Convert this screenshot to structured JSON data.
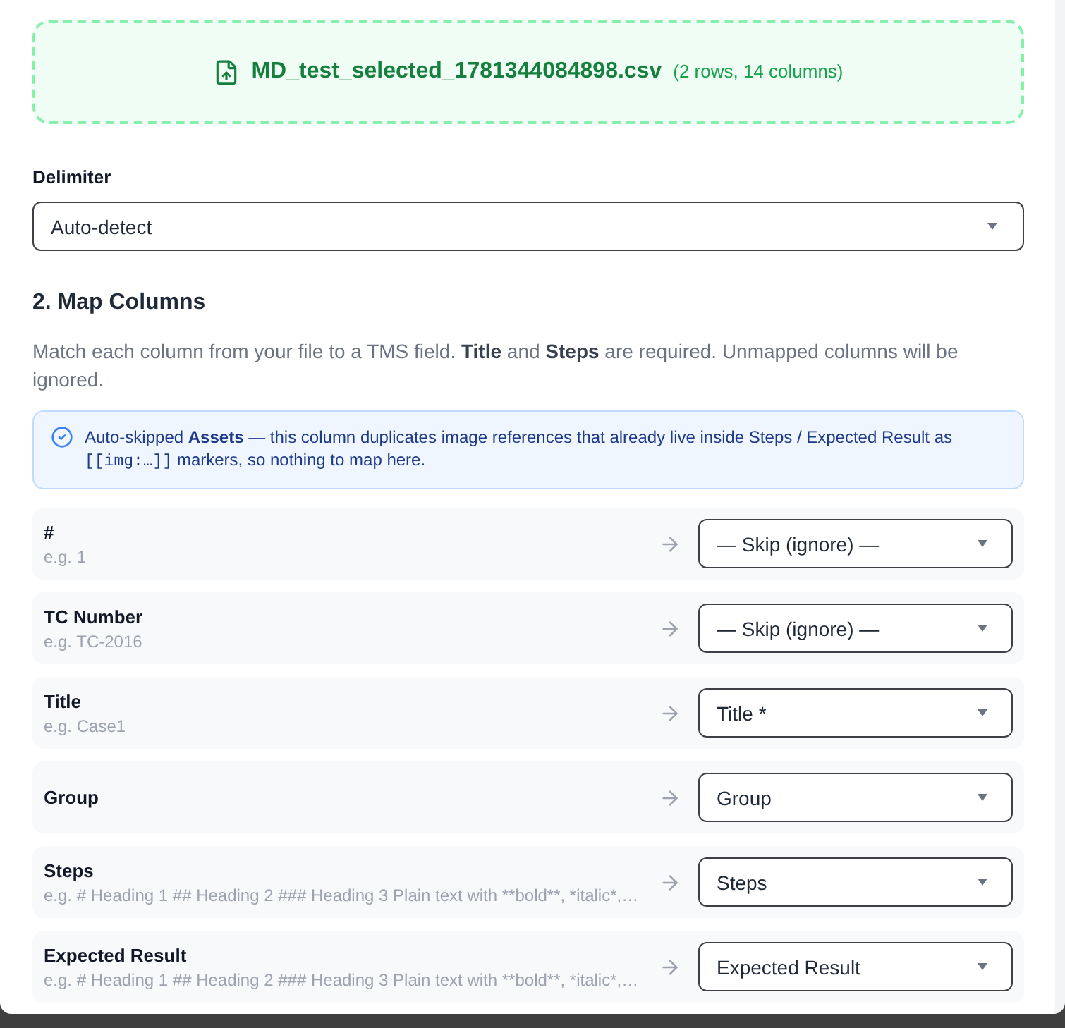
{
  "upload": {
    "file_name": "MD_test_selected_1781344084898.csv",
    "summary": "(2 rows, 14 columns)"
  },
  "delimiter": {
    "label": "Delimiter",
    "value": "Auto-detect"
  },
  "map_columns": {
    "heading": "2. Map Columns",
    "description": "Match each column from your file to a TMS field. **Title** and **Steps** are required. Unmapped columns will be ignored.",
    "notice": {
      "text": "Auto-skipped **Assets** — this column duplicates image references that already live inside Steps / Expected Result as",
      "code": "[[img:…]]",
      "text_after": "markers, so nothing to map here."
    },
    "rows": [
      {
        "column": "#",
        "example": "e.g. 1",
        "mapping": "— Skip (ignore) —"
      },
      {
        "column": "TC Number",
        "example": "e.g. TC-2016",
        "mapping": "— Skip (ignore) —"
      },
      {
        "column": "Title",
        "example": "e.g. Case1",
        "mapping": "Title *"
      },
      {
        "column": "Group",
        "mapping": "Group"
      },
      {
        "column": "Steps",
        "example": "e.g. # Heading 1 ## Heading 2 ### Heading 3 Plain text with **bold**, *italic*,…",
        "mapping": "Steps"
      },
      {
        "column": "Expected Result",
        "example": "e.g. # Heading 1 ## Heading 2 ### Heading 3 Plain text with **bold**, *italic*,…",
        "mapping": "Expected Result"
      }
    ]
  }
}
